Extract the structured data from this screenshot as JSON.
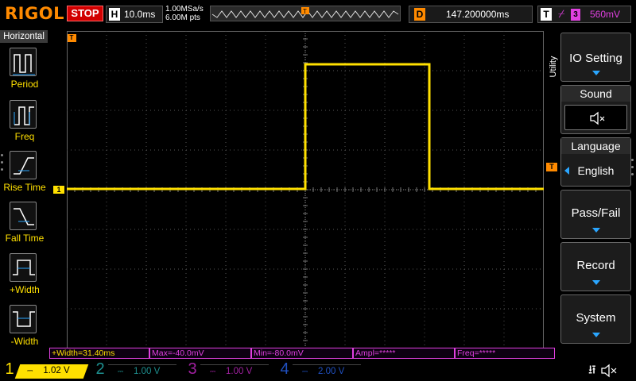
{
  "header": {
    "brand": "RIGOL",
    "run_state": "STOP",
    "horizontal_key": "H",
    "timebase": "10.0ms",
    "sample_rate": "1.00MSa/s",
    "memory_depth": "6.00M pts",
    "delay_key": "D",
    "delay_value": "147.200000ms",
    "trigger_key": "T",
    "trigger_source": "3",
    "trigger_level": "560mV"
  },
  "left_menu": {
    "title": "Horizontal",
    "items": [
      {
        "label": "Period",
        "icon": "period-icon"
      },
      {
        "label": "Freq",
        "icon": "freq-icon"
      },
      {
        "label": "Rise Time",
        "icon": "rise-time-icon"
      },
      {
        "label": "Fall Time",
        "icon": "fall-time-icon"
      },
      {
        "label": "+Width",
        "icon": "pos-width-icon"
      },
      {
        "label": "-Width",
        "icon": "neg-width-icon"
      }
    ]
  },
  "markers": {
    "channel1": "1",
    "trigger_right": "T",
    "trigger_top": "T"
  },
  "right_menu": {
    "tab_label": "Utility",
    "io_setting": "IO Setting",
    "sound_title": "Sound",
    "sound_icon": "speaker-muted-icon",
    "language_title": "Language",
    "language_value": "English",
    "pass_fail": "Pass/Fail",
    "record": "Record",
    "system": "System"
  },
  "measurements": [
    "+Width=31.40ms",
    "Max=-40.0mV",
    "Min=-80.0mV",
    "Ampl=*****",
    "Freq=*****"
  ],
  "channels": [
    {
      "num": "1",
      "scale": "1.02 V",
      "color": "#ffe000",
      "active": true
    },
    {
      "num": "2",
      "scale": "1.00 V",
      "color": "#1e8f8f",
      "active": false
    },
    {
      "num": "3",
      "scale": "1.00 V",
      "color": "#a020a0",
      "active": false
    },
    {
      "num": "4",
      "scale": "2.00 V",
      "color": "#2050c0",
      "active": false
    }
  ],
  "status": {
    "usb_icon": "usb-icon",
    "sound_icon": "speaker-muted-icon"
  },
  "colors": {
    "trace": "#ffe000",
    "grid": "#555555",
    "accent_orange": "#ff8a00",
    "menu_arrow": "#2aa6ff",
    "measure": "#e040e0"
  }
}
